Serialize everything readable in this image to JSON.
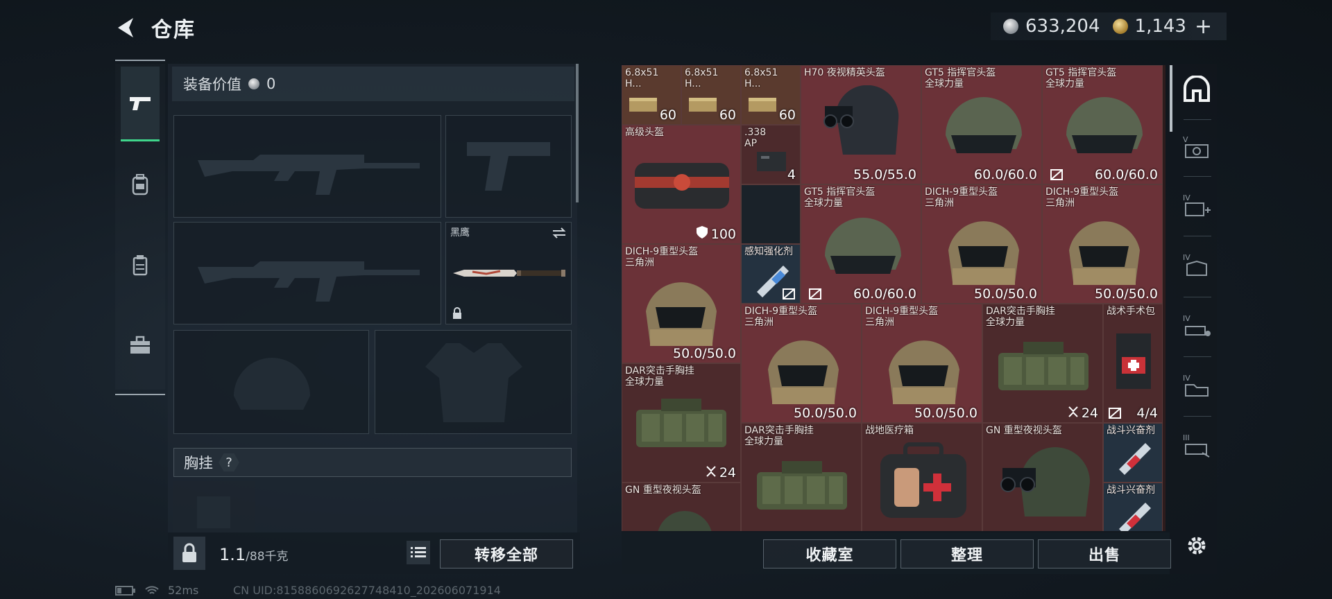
{
  "header": {
    "title": "仓库",
    "currency_silver": "633,204",
    "currency_gold": "1,143",
    "plus_label": "+"
  },
  "left_tabs": [
    "weapons",
    "backpack",
    "vest",
    "case"
  ],
  "equipment": {
    "value_label": "装备价值",
    "value": "0",
    "knife_name": "黑鹰",
    "section_chest_rig": "胸挂",
    "section_help": "?",
    "weight_current": "1.1",
    "weight_max": "/88千克",
    "transfer_all": "转移全部"
  },
  "inventory": {
    "items": [
      {
        "name": "6.8x51\nH...",
        "value": "60"
      },
      {
        "name": "6.8x51\nH...",
        "value": "60"
      },
      {
        "name": "6.8x51\nH...",
        "value": "60"
      },
      {
        "name": "H70 夜视精英头盔",
        "value": "55.0/55.0"
      },
      {
        "name": "GT5 指挥官头盔\n全球力量",
        "value": "60.0/60.0"
      },
      {
        "name": "GT5 指挥官头盔\n全球力量",
        "value": "60.0/60.0"
      },
      {
        "name": "高级头盔",
        "value": "100"
      },
      {
        "name": ".338\nAP",
        "value": "4"
      },
      {
        "name": "GT5 指挥官头盔\n全球力量",
        "value": "60.0/60.0"
      },
      {
        "name": "DICH-9重型头盔\n三角洲",
        "value": "50.0/50.0"
      },
      {
        "name": "DICH-9重型头盔\n三角洲",
        "value": "50.0/50.0"
      },
      {
        "name": "DICH-9重型头盔\n三角洲",
        "value": "50.0/50.0"
      },
      {
        "name": "感知强化剂",
        "value": ""
      },
      {
        "name": "DICH-9重型头盔\n三角洲",
        "value": "50.0/50.0"
      },
      {
        "name": "DICH-9重型头盔\n三角洲",
        "value": "50.0/50.0"
      },
      {
        "name": "DAR突击手胸挂\n全球力量",
        "value": "24"
      },
      {
        "name": "战术手术包",
        "value": "4/4"
      },
      {
        "name": "DAR突击手胸挂\n全球力量",
        "value": "24"
      },
      {
        "name": "DAR突击手胸挂\n全球力量",
        "value": ""
      },
      {
        "name": "战地医疗箱",
        "value": ""
      },
      {
        "name": "GN 重型夜视头盔",
        "value": ""
      },
      {
        "name": "战斗兴奋剂",
        "value": ""
      },
      {
        "name": "战斗兴奋剂",
        "value": ""
      },
      {
        "name": "GN 重型夜视头盔",
        "value": ""
      }
    ],
    "btn_collection": "收藏室",
    "btn_organize": "整理",
    "btn_sell": "出售"
  },
  "categories": [
    "helmet",
    "V",
    "IV",
    "IV",
    "IV",
    "IV",
    "III"
  ],
  "status": {
    "ping": "52ms",
    "uid": "CN UID:8158860692627748410_202606071914"
  },
  "colors": {
    "accent_green": "#3fd58b",
    "cell_red": "#6b3238",
    "cell_blue": "#243240"
  }
}
